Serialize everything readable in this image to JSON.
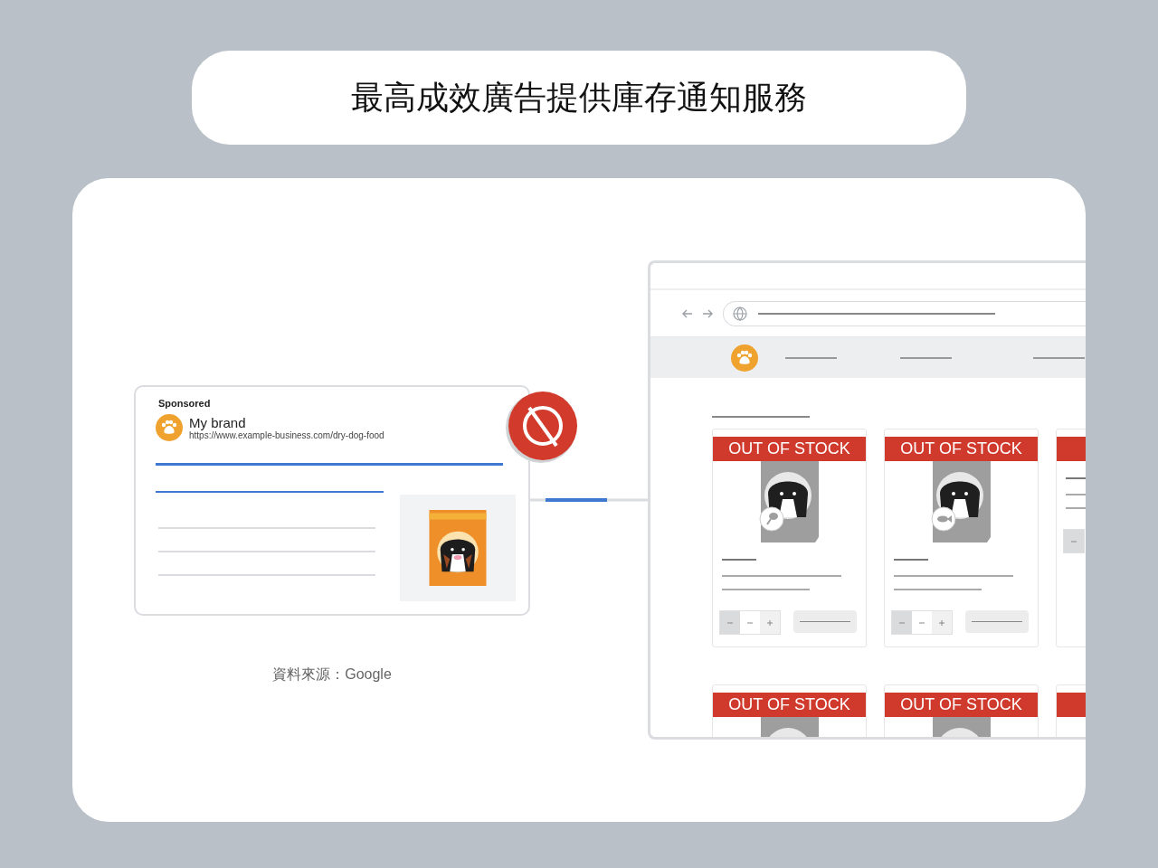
{
  "title": "最高成效廣告提供庫存通知服務",
  "ad": {
    "label": "Sponsored",
    "brand": "My brand",
    "url": "https://www.example-business.com/dry-dog-food"
  },
  "source": "資料來源：Google",
  "products": [
    {
      "kind": "chicken",
      "badge": "OUT OF STOCK"
    },
    {
      "kind": "fish",
      "badge": "OUT OF STOCK"
    },
    {
      "kind": "cut"
    },
    {
      "kind": "top",
      "badge": "OUT OF STOCK"
    },
    {
      "kind": "top",
      "badge": "OUT OF STOCK"
    },
    {
      "kind": "cut-top"
    }
  ]
}
